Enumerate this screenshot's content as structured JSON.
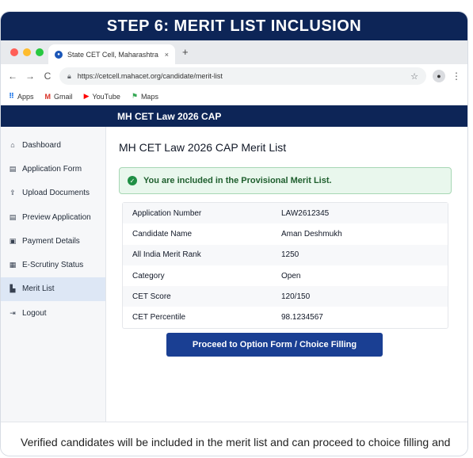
{
  "banner": {
    "title": "STEP 6: MERIT LIST INCLUSION"
  },
  "browser": {
    "dots": [
      "#ff5f57",
      "#febc2e",
      "#28c840"
    ],
    "tab_title": "State CET Cell, Maharashtra",
    "tab_close": "×",
    "new_tab": "+",
    "back": "←",
    "forward": "→",
    "reload": "C",
    "url": "https://cetcell.mahacet.org/candidate/merit-list",
    "bookmarks": [
      {
        "icon": "apps-icon",
        "glyph": "⠿",
        "label": "Apps"
      },
      {
        "icon": "gmail-icon",
        "glyph": "M",
        "label": "Gmail"
      },
      {
        "icon": "youtube-icon",
        "glyph": "▶",
        "label": "YouTube"
      },
      {
        "icon": "maps-icon",
        "glyph": "⚑",
        "label": "Maps"
      }
    ]
  },
  "site": {
    "header": "MH CET Law 2026 CAP",
    "sidebar": [
      {
        "label": "Dashboard",
        "icon": "home-icon",
        "glyph": "⌂",
        "active": false
      },
      {
        "label": "Application Form",
        "icon": "form-icon",
        "glyph": "▤",
        "active": false
      },
      {
        "label": "Upload Documents",
        "icon": "upload-icon",
        "glyph": "⇪",
        "active": false
      },
      {
        "label": "Preview Application",
        "icon": "preview-icon",
        "glyph": "▤",
        "active": false
      },
      {
        "label": "Payment Details",
        "icon": "payment-icon",
        "glyph": "▣",
        "active": false
      },
      {
        "label": "E-Scrutiny Status",
        "icon": "scrutiny-icon",
        "glyph": "▦",
        "active": false
      },
      {
        "label": "Merit List",
        "icon": "merit-list-icon",
        "glyph": "▙",
        "active": true
      },
      {
        "label": "Logout",
        "icon": "logout-icon",
        "glyph": "⇥",
        "active": false
      }
    ],
    "page_title": "MH CET Law 2026 CAP Merit List",
    "alert": "You are included in the Provisional Merit List.",
    "details": [
      {
        "label": "Application Number",
        "value": "LAW2612345"
      },
      {
        "label": "Candidate Name",
        "value": "Aman Deshmukh"
      },
      {
        "label": "All India Merit Rank",
        "value": "1250"
      },
      {
        "label": "Category",
        "value": "Open"
      },
      {
        "label": "CET Score",
        "value": "120/150"
      },
      {
        "label": "CET Percentile",
        "value": "98.1234567"
      }
    ],
    "cta": "Proceed to Option Form / Choice Filling"
  },
  "footer": "Verified candidates will be included in the merit list and can proceed to choice filling and seat allotment.",
  "colors": {
    "navy": "#0d2557",
    "cta": "#1a3f93",
    "success_bg": "#e9f7ed",
    "active_nav": "#dde7f5"
  }
}
